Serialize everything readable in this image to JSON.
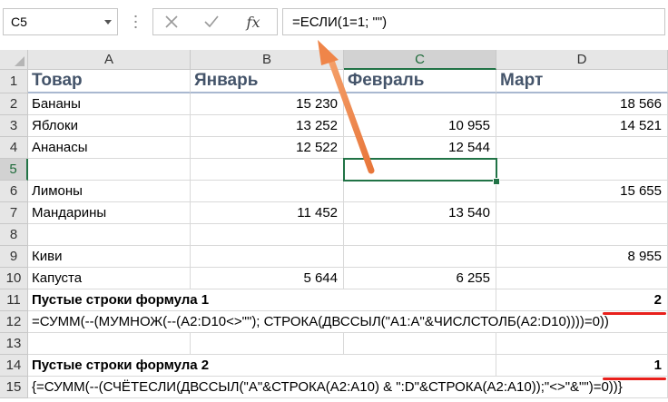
{
  "formula_bar": {
    "name_box": "C5",
    "formula": "=ЕСЛИ(1=1; \"\")",
    "fx_label": "fx"
  },
  "columns": [
    "A",
    "B",
    "C",
    "D"
  ],
  "rows": [
    "1",
    "2",
    "3",
    "4",
    "5",
    "6",
    "7",
    "8",
    "9",
    "10",
    "11",
    "12",
    "13",
    "14",
    "15"
  ],
  "header_row": {
    "a": "Товар",
    "b": "Январь",
    "c": "Февраль",
    "d": "Март"
  },
  "data_rows": [
    {
      "a": "Бананы",
      "b": "15 230",
      "c": "",
      "d": "18 566"
    },
    {
      "a": "Яблоки",
      "b": "13 252",
      "c": "10 955",
      "d": "14 521"
    },
    {
      "a": "Ананасы",
      "b": "12 522",
      "c": "12 544",
      "d": ""
    },
    {
      "a": "",
      "b": "",
      "c": "",
      "d": ""
    },
    {
      "a": "Лимоны",
      "b": "",
      "c": "",
      "d": "15 655"
    },
    {
      "a": "Мандарины",
      "b": "11 452",
      "c": "13 540",
      "d": ""
    },
    {
      "a": "",
      "b": "",
      "c": "",
      "d": ""
    },
    {
      "a": "Киви",
      "b": "",
      "c": "",
      "d": "8 955"
    },
    {
      "a": "Капуста",
      "b": "5 644",
      "c": "6 255",
      "d": ""
    }
  ],
  "row11": {
    "label": "Пустые строки формула 1",
    "value": "2"
  },
  "row12": {
    "formula": "=СУММ(--(МУМНОЖ(--(A2:D10<>\"\"); СТРОКА(ДВССЫЛ(\"A1:A\"&ЧИСЛСТОЛБ(A2:D10))))=0))"
  },
  "row14": {
    "label": "Пустые строки формула 2",
    "value": "1"
  },
  "row15": {
    "formula": "{=СУММ(--(СЧЁТЕСЛИ(ДВССЫЛ(\"A\"&СТРОКА(A2:A10) & \":D\"&СТРОКА(A2:A10));\"<>\"&\"\")=0))}"
  },
  "selected_cell": "C5",
  "colors": {
    "header_text": "#44546a",
    "selection": "#217346",
    "arrow": "#f08a4b",
    "underline": "#e8201c"
  }
}
